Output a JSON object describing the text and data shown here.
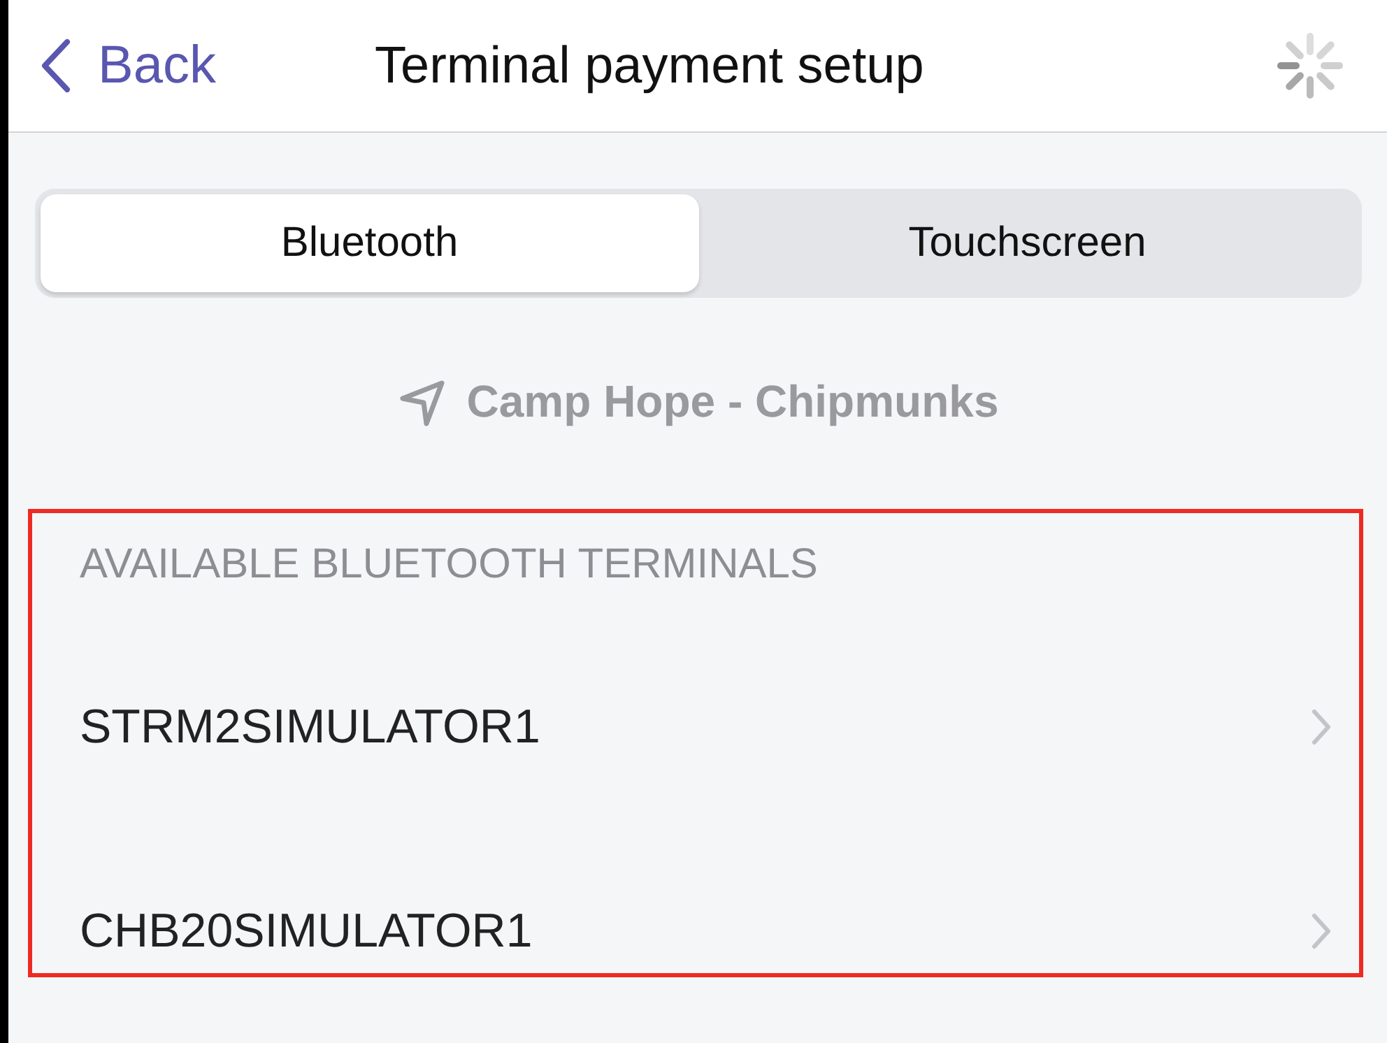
{
  "nav_bar": {
    "back_label": "Back",
    "title": "Terminal payment setup",
    "loading": true
  },
  "tabs": [
    {
      "label": "Bluetooth",
      "selected": true
    },
    {
      "label": "Touchscreen",
      "selected": false
    }
  ],
  "location": "Camp Hope - Chipmunks",
  "section": {
    "header": "AVAILABLE BLUETOOTH TERMINALS",
    "highlighted": true,
    "items": [
      {
        "label": "STRM2SIMULATOR1"
      },
      {
        "label": "CHB20SIMULATOR1"
      }
    ]
  }
}
